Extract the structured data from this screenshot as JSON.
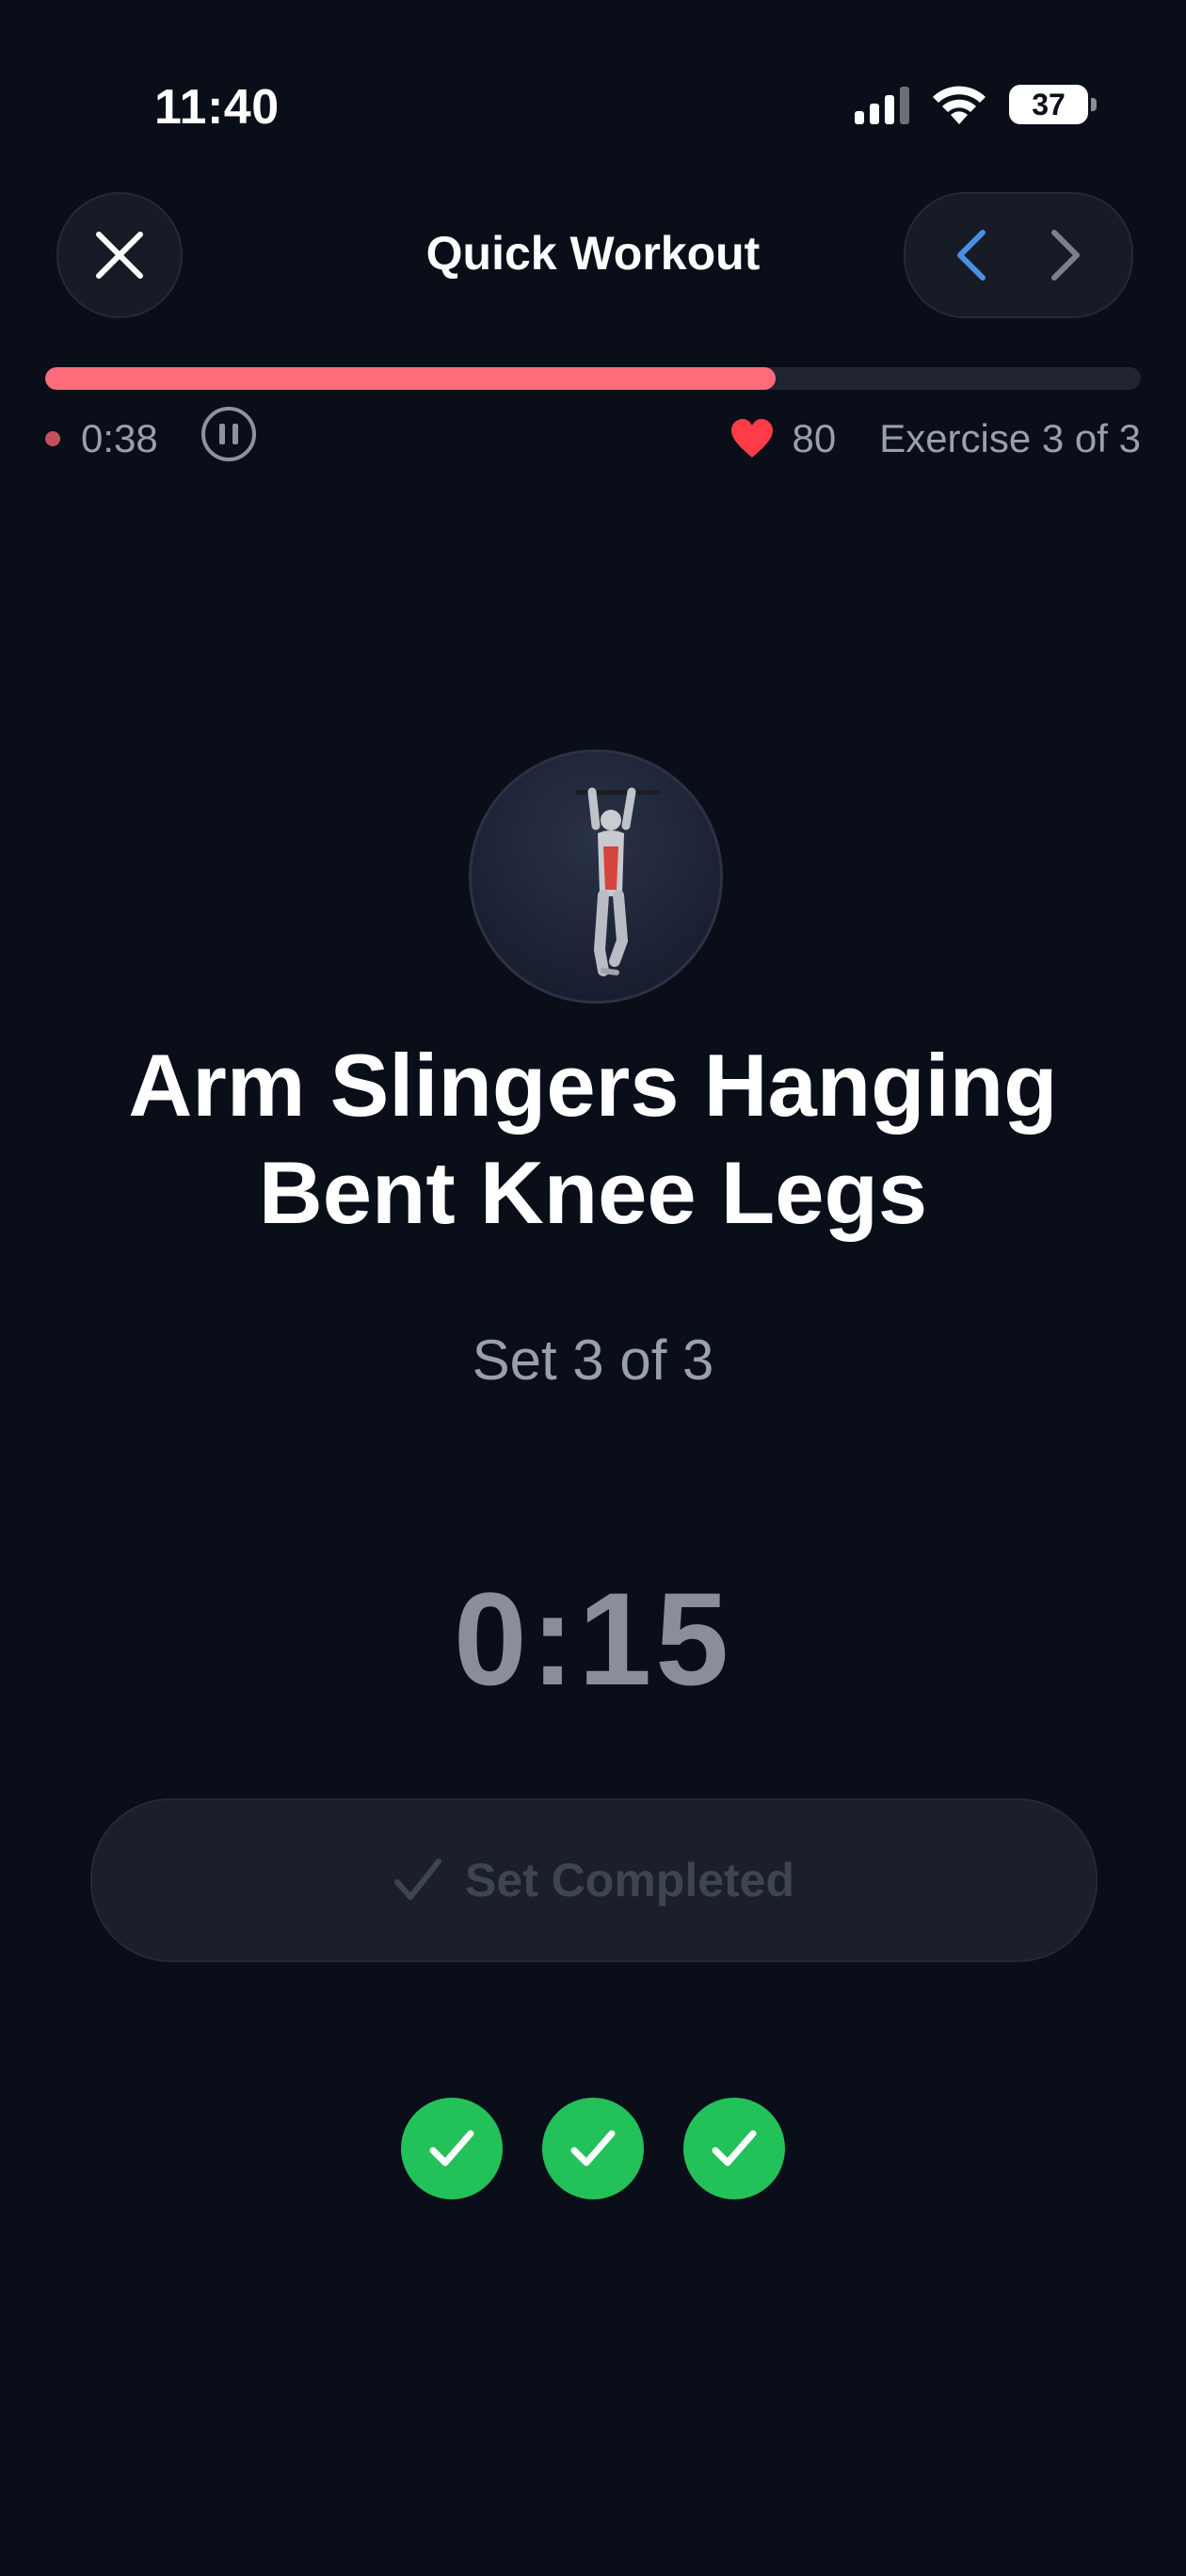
{
  "status_bar": {
    "time": "11:40",
    "battery": "37"
  },
  "header": {
    "title": "Quick Workout"
  },
  "progress": {
    "fraction": 0.667,
    "elapsed": "0:38",
    "heart_rate": "80",
    "exercise_counter": "Exercise 3 of 3"
  },
  "exercise": {
    "name": "Arm Slingers Hanging Bent Knee Legs",
    "set_label": "Set 3 of 3",
    "timer": "0:15"
  },
  "action": {
    "set_completed_label": "Set Completed"
  },
  "sets": [
    {
      "completed": true
    },
    {
      "completed": true
    },
    {
      "completed": true
    }
  ],
  "colors": {
    "accent": "#ff6b7a",
    "success": "#23c15a",
    "nav_prev": "#4a90e2",
    "background": "#0a0e18"
  }
}
